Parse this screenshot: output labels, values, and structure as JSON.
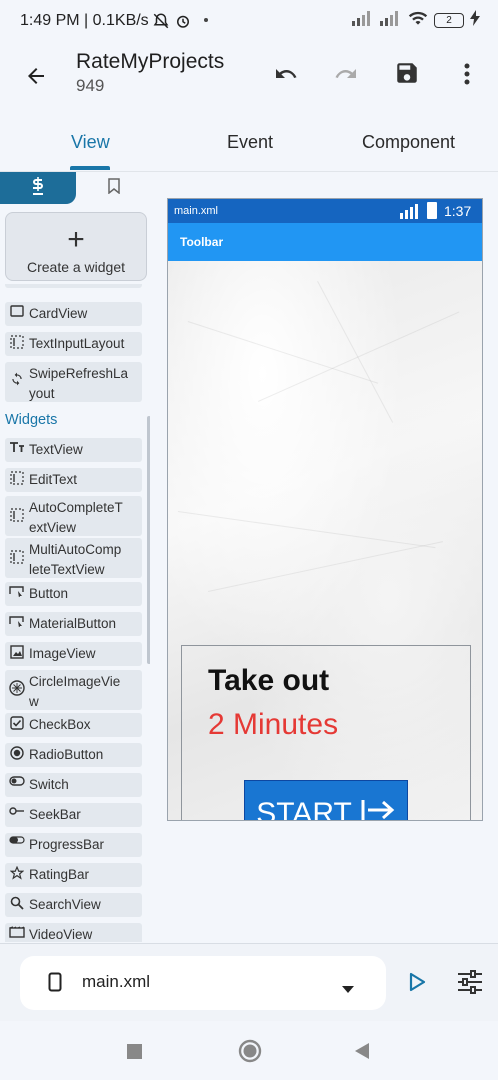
{
  "status_bar": {
    "time": "1:49 PM",
    "speed": "| 0.1KB/s",
    "battery": "2"
  },
  "app_bar": {
    "title": "RateMyProjects",
    "subtitle": "949"
  },
  "tabs": [
    {
      "label": "View",
      "active": true
    },
    {
      "label": "Event",
      "active": false
    },
    {
      "label": "Component",
      "active": false
    }
  ],
  "palette": {
    "create_widget": "Create a widget",
    "items_top": [
      {
        "label": "CardView",
        "icon": "cardview-icon"
      },
      {
        "label": "TextInputLayout",
        "icon": "textinputlayout-icon"
      },
      {
        "label": "SwipeRefreshLa\nyout",
        "icon": "swiperefresh-icon"
      }
    ],
    "widgets_header": "Widgets",
    "widgets": [
      {
        "label": "TextView",
        "icon": "textview-icon"
      },
      {
        "label": "EditText",
        "icon": "edittext-icon"
      },
      {
        "label": "AutoCompleteT\nextView",
        "icon": "autocomplete-icon"
      },
      {
        "label": "MultiAutoComp\nleteTextView",
        "icon": "multiautocomplete-icon"
      },
      {
        "label": "Button",
        "icon": "button-icon"
      },
      {
        "label": "MaterialButton",
        "icon": "materialbutton-icon"
      },
      {
        "label": "ImageView",
        "icon": "imageview-icon"
      },
      {
        "label": "CircleImageVie\nw",
        "icon": "circleimageview-icon"
      },
      {
        "label": "CheckBox",
        "icon": "checkbox-icon"
      },
      {
        "label": "RadioButton",
        "icon": "radiobutton-icon"
      },
      {
        "label": "Switch",
        "icon": "switch-icon"
      },
      {
        "label": "SeekBar",
        "icon": "seekbar-icon"
      },
      {
        "label": "ProgressBar",
        "icon": "progressbar-icon"
      },
      {
        "label": "RatingBar",
        "icon": "ratingbar-icon"
      },
      {
        "label": "SearchView",
        "icon": "searchview-icon"
      },
      {
        "label": "VideoView",
        "icon": "videoview-icon"
      }
    ]
  },
  "preview": {
    "file": "main.xml",
    "time": "1:37",
    "toolbar": "Toolbar",
    "heading": "Take out",
    "minutes": "2 Minutes",
    "start_button": "START",
    "heading_color": "#111111",
    "minutes_color": "#e53935",
    "button_color": "#1976d2"
  },
  "bottom_bar": {
    "file_name": "main.xml"
  },
  "colors": {
    "accent": "#1976a8",
    "toolbar": "#2196f3",
    "status": "#1565c0"
  }
}
